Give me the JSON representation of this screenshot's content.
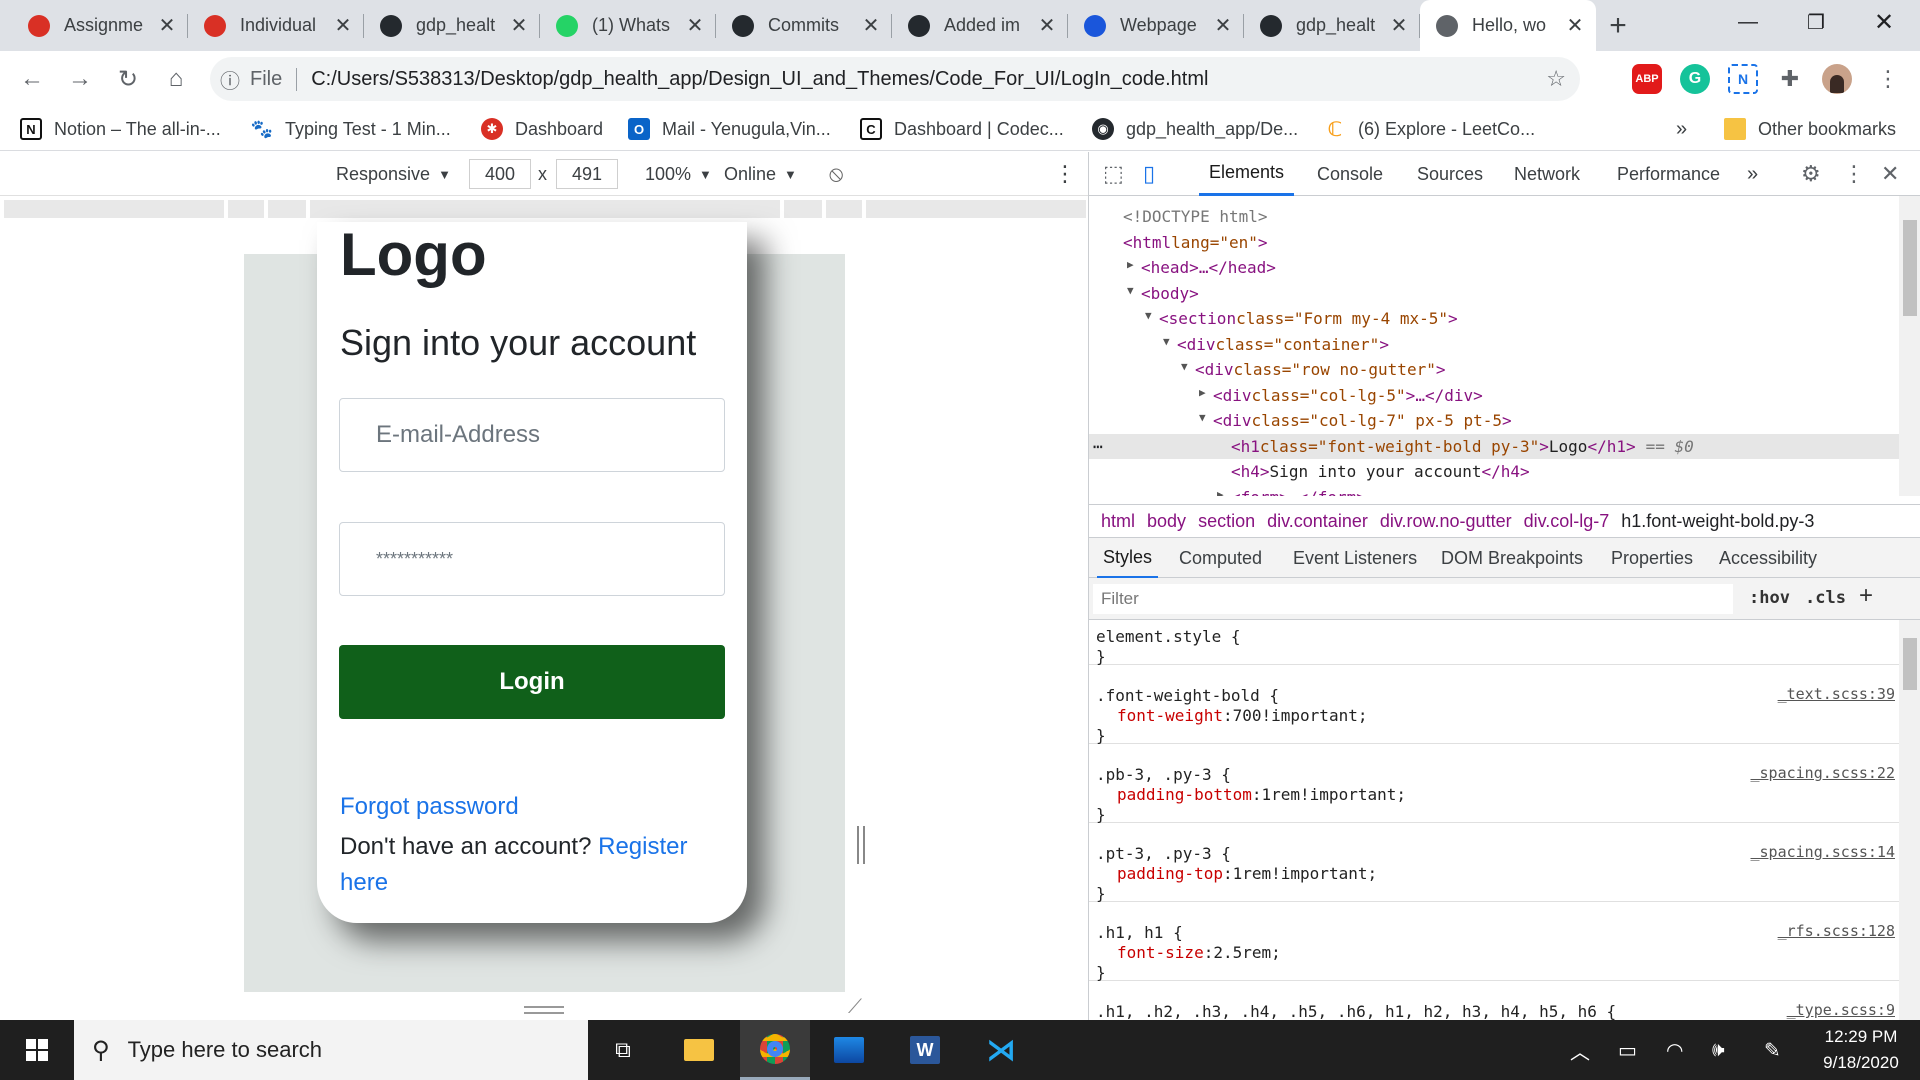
{
  "browser": {
    "tabs": [
      {
        "title": "Assignme",
        "icon": "gear-logo-icon",
        "color": "#d93025"
      },
      {
        "title": "Individual",
        "icon": "gear-logo-icon",
        "color": "#d93025"
      },
      {
        "title": "gdp_healt",
        "icon": "github-icon",
        "color": "#24292e"
      },
      {
        "title": "(1) Whats",
        "icon": "whatsapp-icon",
        "color": "#25d366"
      },
      {
        "title": "Commits",
        "icon": "github-icon",
        "color": "#24292e"
      },
      {
        "title": "Added im",
        "icon": "github-icon",
        "color": "#24292e"
      },
      {
        "title": "Webpage",
        "icon": "m-logo-icon",
        "color": "#1a56db"
      },
      {
        "title": "gdp_healt",
        "icon": "github-icon",
        "color": "#24292e"
      },
      {
        "title": "Hello, wo",
        "icon": "globe-icon",
        "color": "#5f6368",
        "active": true
      }
    ],
    "new_tab": "+",
    "url_scheme": "File",
    "url": "C:/Users/S538313/Desktop/gdp_health_app/Design_UI_and_Themes/Code_For_UI/LogIn_code.html",
    "extensions": [
      "ABP",
      "G",
      "N"
    ],
    "bookmarks": [
      {
        "label": "Notion – The all-in-...",
        "icon": "notion-icon"
      },
      {
        "label": "Typing Test - 1 Min...",
        "icon": "paw-icon"
      },
      {
        "label": "Dashboard",
        "icon": "gear-logo-icon"
      },
      {
        "label": "Mail - Yenugula,Vin...",
        "icon": "outlook-icon"
      },
      {
        "label": "Dashboard | Codec...",
        "icon": "codecademy-icon"
      },
      {
        "label": "gdp_health_app/De...",
        "icon": "github-icon"
      },
      {
        "label": "(6) Explore - LeetCo...",
        "icon": "leetcode-icon"
      }
    ],
    "bookmarks_overflow": "»",
    "other_bookmarks": "Other bookmarks"
  },
  "device_toolbar": {
    "mode": "Responsive",
    "width": "400",
    "times": "x",
    "height": "491",
    "zoom": "100%",
    "network": "Online"
  },
  "page": {
    "logo": "Logo",
    "heading": "Sign into your account",
    "email_placeholder": "E-mail-Address",
    "password_placeholder": "***********",
    "login_button": "Login",
    "forgot_link": "Forgot password",
    "no_account_text": "Don't have an account?",
    "register_link": "Register here",
    "colors": {
      "login_bg": "#10601a",
      "link": "#1a73e8"
    }
  },
  "devtools": {
    "tabs": [
      "Elements",
      "Console",
      "Sources",
      "Network",
      "Performance"
    ],
    "more_tabs": "»",
    "dom_lines": [
      {
        "indent": 0,
        "text": "<!DOCTYPE html>",
        "kind": "doctype"
      },
      {
        "indent": 0,
        "tag": "html",
        "attrs": "lang=\"en\"",
        "arrow": ""
      },
      {
        "indent": 1,
        "tag": "head",
        "collapsed": "…</head>",
        "arrow": "▶"
      },
      {
        "indent": 1,
        "tag": "body",
        "arrow": "▼"
      },
      {
        "indent": 2,
        "tag": "section",
        "attrs": "class=\"Form my-4 mx-5\"",
        "arrow": "▼"
      },
      {
        "indent": 3,
        "tag": "div",
        "attrs": "class=\"container\"",
        "arrow": "▼"
      },
      {
        "indent": 4,
        "tag": "div",
        "attrs": "class=\"row no-gutter\"",
        "arrow": "▼"
      },
      {
        "indent": 5,
        "tag": "div",
        "attrs": "class=\"col-lg-5\"",
        "collapsed": "…</div>",
        "arrow": "▶"
      },
      {
        "indent": 5,
        "tag": "div",
        "attrs": "class=\"col-lg-7\"  px-5 pt-5",
        "arrow": "▼"
      },
      {
        "indent": 6,
        "tag": "h1",
        "attrs": "class=\"font-weight-bold  py-3\"",
        "inner": "Logo",
        "close": "</h1>",
        "suffix": "== $0",
        "selected": true
      },
      {
        "indent": 6,
        "tag": "h4",
        "inner": "Sign into your account",
        "close": "</h4>"
      },
      {
        "indent": 6,
        "tag": "form",
        "collapsed": "…</form>",
        "arrow": "▶"
      }
    ],
    "breadcrumbs": [
      "html",
      "body",
      "section",
      "div.container",
      "div.row.no-gutter",
      "div.col-lg-7",
      "h1.font-weight-bold.py-3"
    ],
    "style_tabs": [
      "Styles",
      "Computed",
      "Event Listeners",
      "DOM Breakpoints",
      "Properties",
      "Accessibility"
    ],
    "filter_placeholder": "Filter",
    "hov": ":hov",
    "cls": ".cls",
    "rules": [
      {
        "selector": "element.style {",
        "decls": [],
        "source": ""
      },
      {
        "selector": ".font-weight-bold {",
        "decls": [
          {
            "p": "font-weight",
            "v": "700!important;"
          }
        ],
        "source": "_text.scss:39"
      },
      {
        "selector": ".pb-3, .py-3 {",
        "decls": [
          {
            "p": "padding-bottom",
            "v": "1rem!important;"
          }
        ],
        "source": "_spacing.scss:22"
      },
      {
        "selector": ".pt-3, .py-3 {",
        "decls": [
          {
            "p": "padding-top",
            "v": "1rem!important;"
          }
        ],
        "source": "_spacing.scss:14"
      },
      {
        "selector": ".h1, h1 {",
        "decls": [
          {
            "p": "font-size",
            "v": "2.5rem;"
          }
        ],
        "source": "_rfs.scss:128"
      },
      {
        "selector": ".h1, .h2, .h3, .h4, .h5, .h6, h1, h2, h3, h4, h5, h6 {",
        "decls": [],
        "source": "_type.scss:9"
      }
    ]
  },
  "taskbar": {
    "search_placeholder": "Type here to search",
    "time": "12:29 PM",
    "date": "9/18/2020"
  }
}
